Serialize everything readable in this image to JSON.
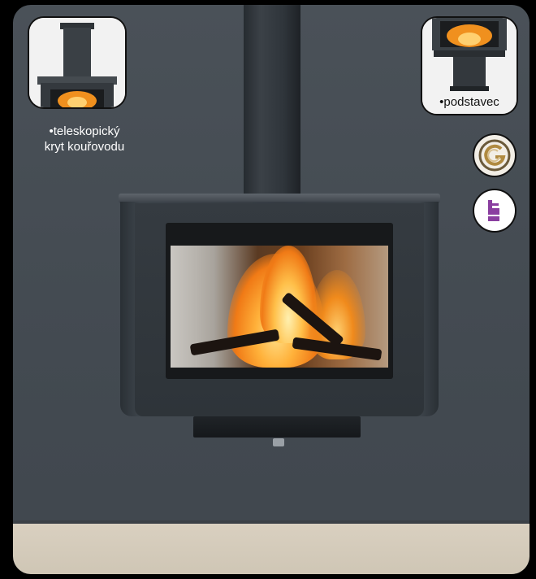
{
  "captions": {
    "telescopic_line1": "•teleskopický",
    "telescopic_line2": "kryt kouřovodu",
    "stand": "•podstavec"
  },
  "icons": {
    "badge_1": "circular-g-emblem-icon",
    "badge_2": "purple-fuel-icon"
  },
  "colors": {
    "wall": "#454c53",
    "floor": "#d6cdbc",
    "flame": "#f08a1c",
    "badge_purple": "#8a3ea0",
    "badge_gold": "#b08a40"
  }
}
